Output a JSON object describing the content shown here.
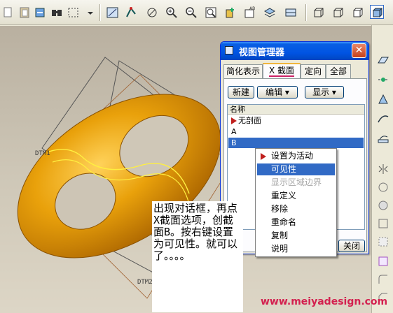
{
  "dialog": {
    "title": "视图管理器",
    "close_glyph": "✕",
    "tabs": [
      {
        "label": "简化表示"
      },
      {
        "label": "X 截面"
      },
      {
        "label": "定向"
      },
      {
        "label": "全部"
      }
    ],
    "active_tab": "X 截面",
    "buttons": {
      "new": "新建",
      "edit": "编辑 ▾",
      "display": "显示 ▾"
    },
    "list_header": "名称",
    "list_items": [
      {
        "label": "无剖面",
        "icon": "red-arrow-icon"
      },
      {
        "label": "A"
      },
      {
        "label": "B",
        "selected": true
      }
    ],
    "close_button": "关闭"
  },
  "context_menu": {
    "items": [
      {
        "label": "设置为活动",
        "icon": "red-arrow-icon"
      },
      {
        "label": "可见性",
        "highlighted": true
      },
      {
        "label": "显示区域边界",
        "disabled": true
      },
      {
        "label": "重定义"
      },
      {
        "label": "移除"
      },
      {
        "label": "重命名"
      },
      {
        "label": "复制"
      },
      {
        "label": "说明"
      }
    ]
  },
  "viewport": {
    "datum_labels": [
      "DTM1",
      "DTM2"
    ],
    "model_color": "#e8a20a"
  },
  "annotation": {
    "text": "出现对话框，再点X截面选项，创截面B。按右键设置为可见性。就可以了。。。。"
  },
  "watermark": "www.meiyadesign.com",
  "colors": {
    "title_bar": "#0054e3",
    "selection": "#316ac5",
    "watermark": "#d3204f",
    "tab_underline": "#cc2266"
  }
}
